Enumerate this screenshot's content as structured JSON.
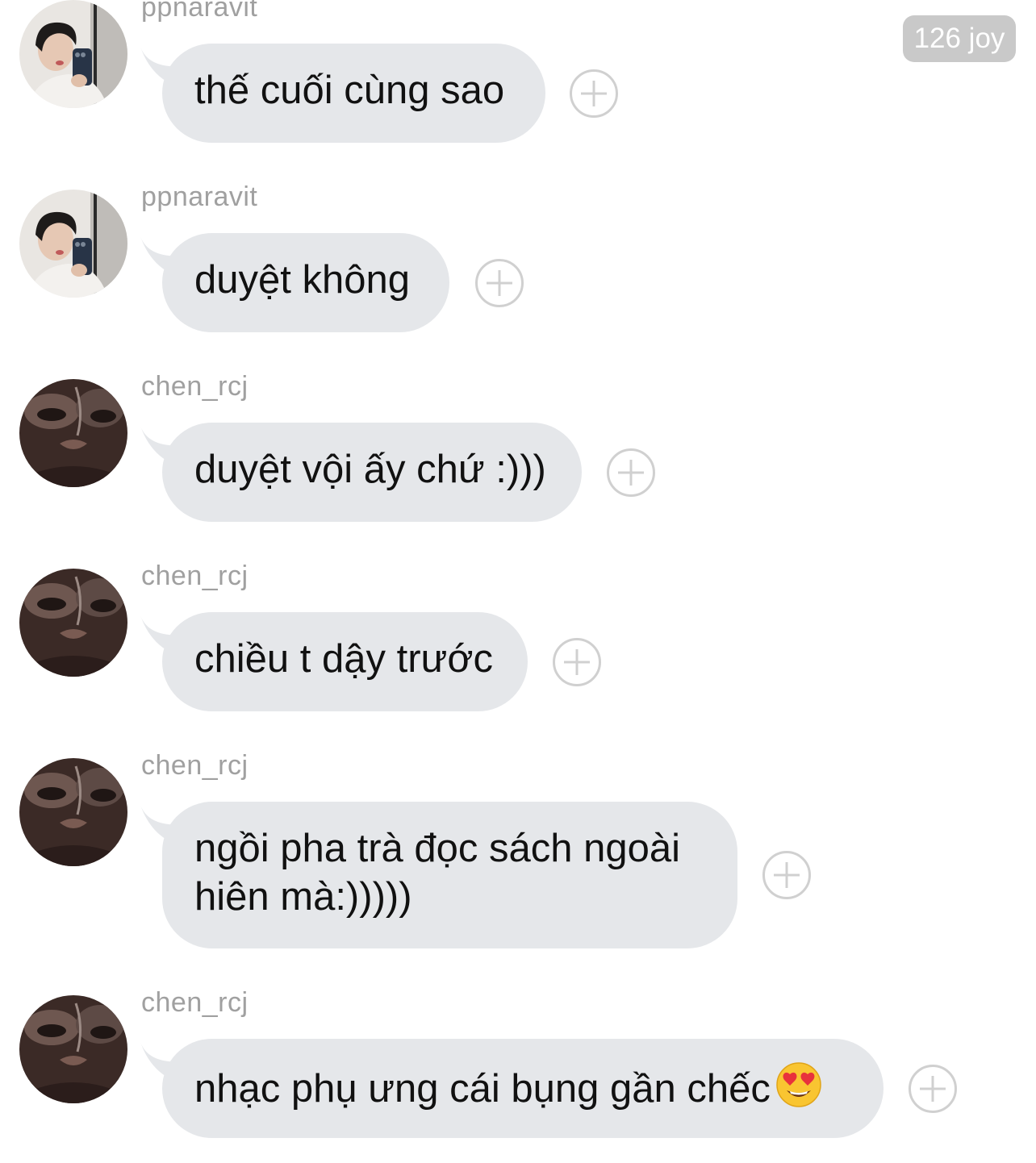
{
  "header": {
    "badge": "126 joy"
  },
  "messages": [
    {
      "username": "ppnaravit",
      "text": "thế cuối cùng sao",
      "avatar": "avatar-ppnaravit-icon"
    },
    {
      "username": "ppnaravit",
      "text": "duyệt không",
      "avatar": "avatar-ppnaravit-icon"
    },
    {
      "username": "chen_rcj",
      "text": "duyệt vội ấy chứ :)))",
      "avatar": "avatar-chen-rcj-icon"
    },
    {
      "username": "chen_rcj",
      "text": "chiều t dậy trước",
      "avatar": "avatar-chen-rcj-icon"
    },
    {
      "username": "chen_rcj",
      "text": "ngồi pha trà đọc sách ngoài\nhiên mà:)))))",
      "avatar": "avatar-chen-rcj-icon"
    },
    {
      "username": "chen_rcj",
      "text": "nhạc phụ ưng cái bụng gần chếc",
      "avatar": "avatar-chen-rcj-icon",
      "emoji": "heart-eyes-emoji-icon"
    }
  ],
  "add_reaction_icon": "plus-circle-icon",
  "colors": {
    "bubble": "#e5e7ea",
    "badge": "#c9c9c9",
    "username": "#a0a0a0"
  }
}
